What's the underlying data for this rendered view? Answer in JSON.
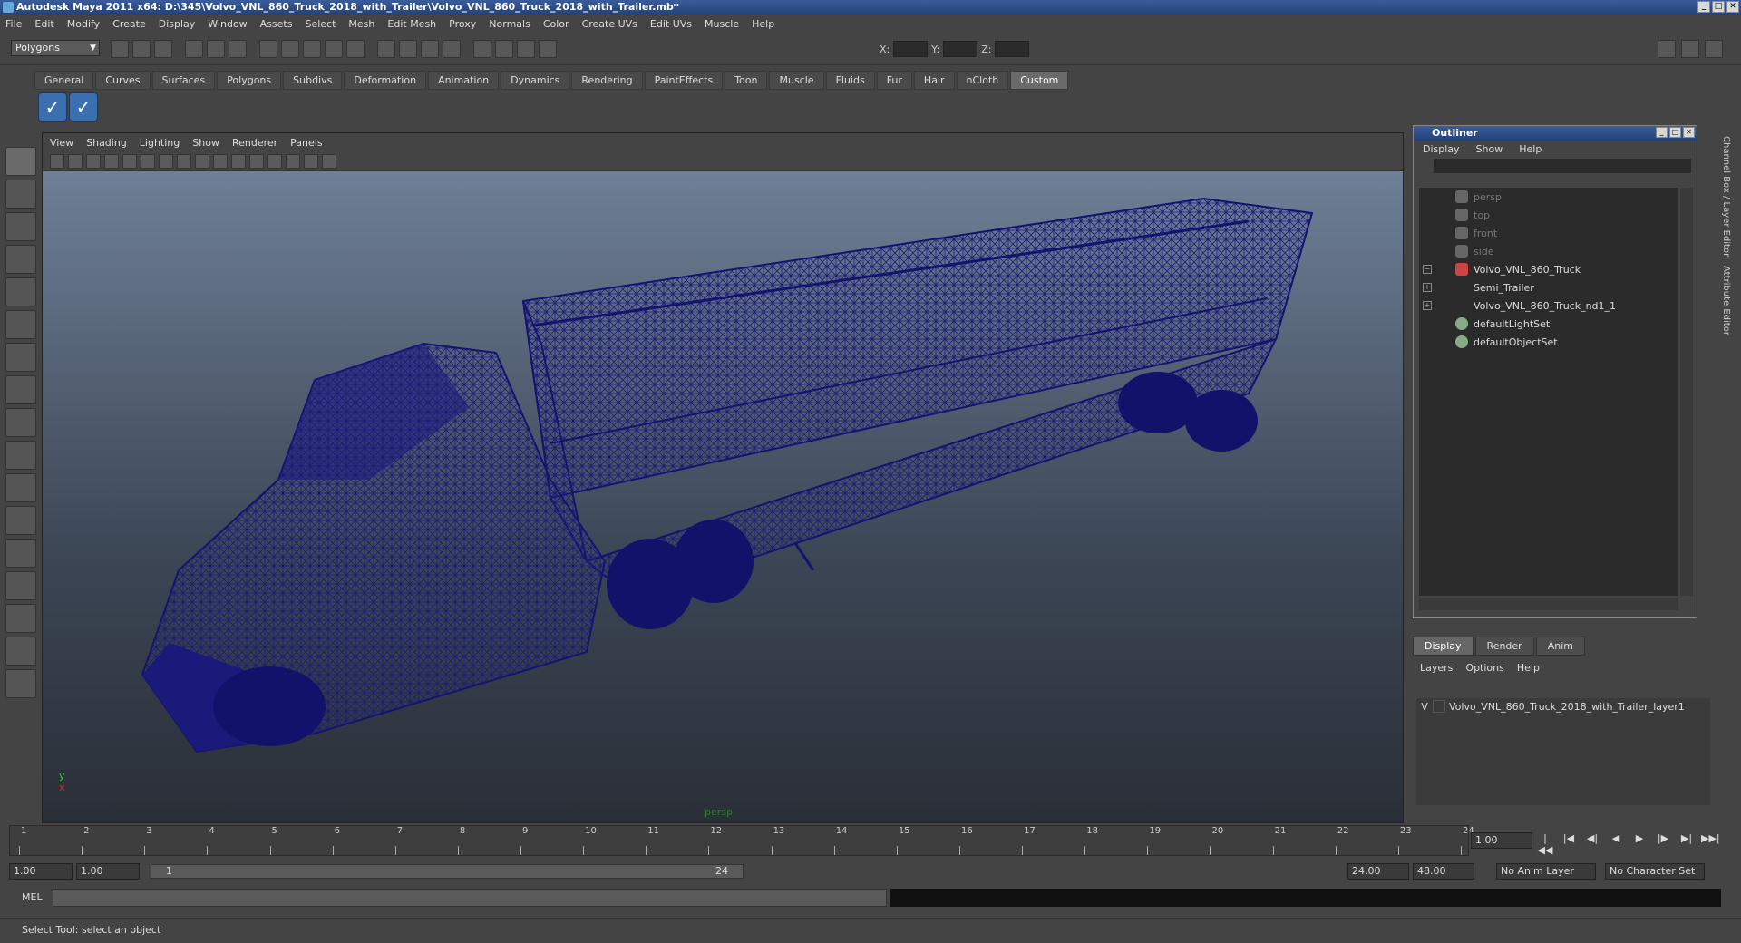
{
  "window": {
    "title": "Autodesk Maya 2011 x64: D:\\345\\Volvo_VNL_860_Truck_2018_with_Trailer\\Volvo_VNL_860_Truck_2018_with_Trailer.mb*"
  },
  "menubar": [
    "File",
    "Edit",
    "Modify",
    "Create",
    "Display",
    "Window",
    "Assets",
    "Select",
    "Mesh",
    "Edit Mesh",
    "Proxy",
    "Normals",
    "Color",
    "Create UVs",
    "Edit UVs",
    "Muscle",
    "Help"
  ],
  "status": {
    "mode": "Polygons",
    "x_label": "X:",
    "y_label": "Y:",
    "z_label": "Z:"
  },
  "shelf": {
    "tabs": [
      "General",
      "Curves",
      "Surfaces",
      "Polygons",
      "Subdivs",
      "Deformation",
      "Animation",
      "Dynamics",
      "Rendering",
      "PaintEffects",
      "Toon",
      "Muscle",
      "Fluids",
      "Fur",
      "Hair",
      "nCloth",
      "Custom"
    ],
    "active": "Custom"
  },
  "viewport": {
    "menu": [
      "View",
      "Shading",
      "Lighting",
      "Show",
      "Renderer",
      "Panels"
    ],
    "camera": "persp",
    "axis_x": "x",
    "axis_y": "y",
    "wire_color": "#1a1a7a"
  },
  "outliner": {
    "title": "Outliner",
    "menu": [
      "Display",
      "Show",
      "Help"
    ],
    "items": [
      {
        "label": "persp",
        "dim": true
      },
      {
        "label": "top",
        "dim": true
      },
      {
        "label": "front",
        "dim": true
      },
      {
        "label": "side",
        "dim": true
      },
      {
        "label": "Volvo_VNL_860_Truck",
        "dim": false
      },
      {
        "label": "Semi_Trailer",
        "dim": false
      },
      {
        "label": "Volvo_VNL_860_Truck_nd1_1",
        "dim": false
      },
      {
        "label": "defaultLightSet",
        "dim": false
      },
      {
        "label": "defaultObjectSet",
        "dim": false
      }
    ]
  },
  "layers": {
    "tabs": [
      "Display",
      "Render",
      "Anim"
    ],
    "menu": [
      "Layers",
      "Options",
      "Help"
    ],
    "layer_v": "V",
    "layer_name": "Volvo_VNL_860_Truck_2018_with_Trailer_layer1"
  },
  "side_tabs": [
    "Channel Box / Layer Editor",
    "Attribute Editor"
  ],
  "timeline": {
    "ticks": [
      "1",
      "2",
      "3",
      "4",
      "5",
      "6",
      "7",
      "8",
      "9",
      "10",
      "11",
      "12",
      "13",
      "14",
      "15",
      "16",
      "17",
      "18",
      "19",
      "20",
      "21",
      "22",
      "23",
      "24"
    ],
    "current": "1.00",
    "marker": "1"
  },
  "range": {
    "start": "1.00",
    "start2": "1.00",
    "slider_start": "1",
    "slider_end": "24",
    "end": "24.00",
    "end2": "48.00",
    "anim_layer": "No Anim Layer",
    "char_set": "No Character Set"
  },
  "cmd": {
    "label": "MEL"
  },
  "help": {
    "text": "Select Tool: select an object"
  }
}
